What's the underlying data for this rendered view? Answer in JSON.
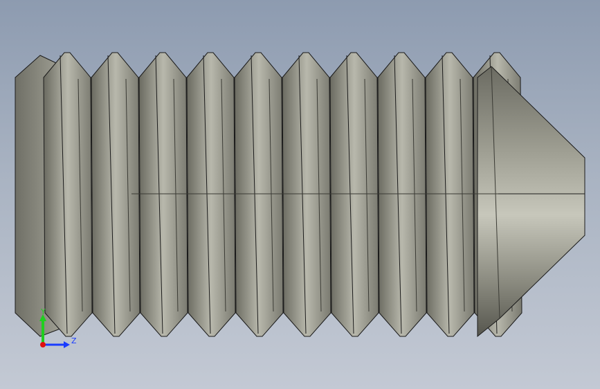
{
  "viewport": {
    "background_top": "#8d9bb0",
    "background_bottom": "#c3c9d4"
  },
  "model": {
    "part": "set-screw-cone-point",
    "thread_count": 10,
    "metal_color_light": "#c9c9bd",
    "metal_color_mid": "#8f8f84",
    "metal_color_dark": "#4e4e47",
    "edge_color": "#1a1a1a"
  },
  "triad": {
    "y_label": "Y",
    "z_label": "Z",
    "y_color": "#1fcf1f",
    "z_color": "#1a3cff",
    "x_color": "#e01010"
  }
}
